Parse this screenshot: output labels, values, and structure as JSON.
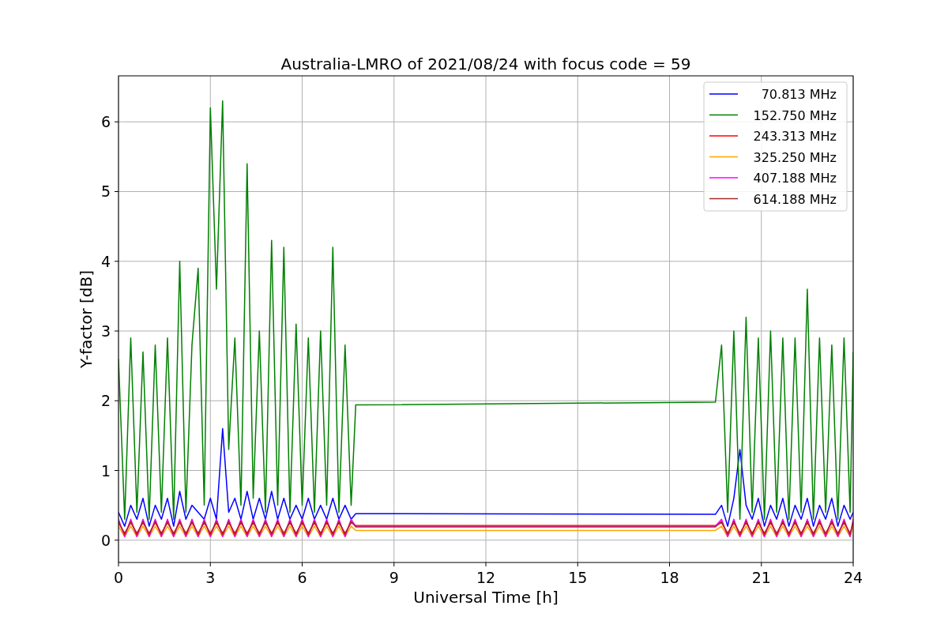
{
  "chart_data": {
    "type": "line",
    "title": "Australia-LMRO of 2021/08/24 with focus code = 59",
    "xlabel": "Universal Time [h]",
    "ylabel": "Y-factor [dB]",
    "x": [
      0,
      0.2,
      0.4,
      0.6,
      0.8,
      1.0,
      1.2,
      1.4,
      1.6,
      1.8,
      2.0,
      2.2,
      2.4,
      2.6,
      2.8,
      3.0,
      3.2,
      3.4,
      3.6,
      3.8,
      4.0,
      4.2,
      4.4,
      4.6,
      4.8,
      5.0,
      5.2,
      5.4,
      5.6,
      5.8,
      6.0,
      6.2,
      6.4,
      6.6,
      6.8,
      7.0,
      7.2,
      7.4,
      7.6,
      7.75,
      19.5,
      19.7,
      19.9,
      20.1,
      20.3,
      20.5,
      20.7,
      20.9,
      21.1,
      21.3,
      21.5,
      21.7,
      21.9,
      22.1,
      22.3,
      22.5,
      22.7,
      22.9,
      23.1,
      23.3,
      23.5,
      23.7,
      23.9,
      24
    ],
    "series": [
      {
        "name": "70.813 MHz",
        "color": "#0000ff",
        "values": [
          0.4,
          0.2,
          0.5,
          0.3,
          0.6,
          0.2,
          0.5,
          0.3,
          0.6,
          0.2,
          0.7,
          0.3,
          0.5,
          0.4,
          0.3,
          0.6,
          0.3,
          1.6,
          0.4,
          0.6,
          0.3,
          0.7,
          0.3,
          0.6,
          0.3,
          0.7,
          0.3,
          0.6,
          0.3,
          0.5,
          0.3,
          0.6,
          0.3,
          0.5,
          0.3,
          0.6,
          0.3,
          0.5,
          0.3,
          0.38,
          0.37,
          0.5,
          0.2,
          0.6,
          1.3,
          0.5,
          0.3,
          0.6,
          0.2,
          0.5,
          0.3,
          0.6,
          0.2,
          0.5,
          0.3,
          0.6,
          0.2,
          0.5,
          0.3,
          0.6,
          0.2,
          0.5,
          0.3,
          0.4
        ]
      },
      {
        "name": "152.750 MHz",
        "color": "#008000",
        "values": [
          2.6,
          0.3,
          2.9,
          0.4,
          2.7,
          0.3,
          2.8,
          0.4,
          2.9,
          0.3,
          4.0,
          0.4,
          2.8,
          3.9,
          0.5,
          6.2,
          3.6,
          6.3,
          1.3,
          2.9,
          0.5,
          5.4,
          0.6,
          3.0,
          0.4,
          4.3,
          0.5,
          4.2,
          0.4,
          3.1,
          0.5,
          2.9,
          0.4,
          3.0,
          0.5,
          4.2,
          0.4,
          2.8,
          0.5,
          1.94,
          1.98,
          2.8,
          0.4,
          3.0,
          0.3,
          3.2,
          0.4,
          2.9,
          0.3,
          3.0,
          0.4,
          2.9,
          0.3,
          2.9,
          0.4,
          3.6,
          0.3,
          2.9,
          0.4,
          2.8,
          0.3,
          2.9,
          0.4,
          2.7
        ]
      },
      {
        "name": "243.313 MHz",
        "color": "#ff0000",
        "values": [
          0.25,
          0.1,
          0.25,
          0.1,
          0.25,
          0.1,
          0.25,
          0.1,
          0.25,
          0.1,
          0.25,
          0.1,
          0.25,
          0.1,
          0.25,
          0.1,
          0.25,
          0.1,
          0.25,
          0.1,
          0.25,
          0.1,
          0.25,
          0.1,
          0.25,
          0.1,
          0.25,
          0.1,
          0.25,
          0.1,
          0.25,
          0.1,
          0.25,
          0.1,
          0.25,
          0.1,
          0.25,
          0.1,
          0.25,
          0.21,
          0.21,
          0.25,
          0.1,
          0.25,
          0.1,
          0.25,
          0.1,
          0.25,
          0.1,
          0.25,
          0.1,
          0.25,
          0.1,
          0.25,
          0.1,
          0.25,
          0.1,
          0.25,
          0.1,
          0.25,
          0.1,
          0.25,
          0.1,
          0.25
        ]
      },
      {
        "name": "325.250 MHz",
        "color": "#ffa500",
        "values": [
          0.2,
          0.05,
          0.2,
          0.05,
          0.2,
          0.05,
          0.2,
          0.05,
          0.2,
          0.05,
          0.2,
          0.05,
          0.2,
          0.05,
          0.2,
          0.05,
          0.2,
          0.05,
          0.2,
          0.05,
          0.2,
          0.05,
          0.2,
          0.05,
          0.2,
          0.05,
          0.2,
          0.05,
          0.2,
          0.05,
          0.2,
          0.05,
          0.2,
          0.05,
          0.2,
          0.05,
          0.2,
          0.05,
          0.2,
          0.14,
          0.14,
          0.2,
          0.05,
          0.2,
          0.05,
          0.2,
          0.05,
          0.2,
          0.05,
          0.2,
          0.05,
          0.2,
          0.05,
          0.2,
          0.05,
          0.2,
          0.05,
          0.2,
          0.05,
          0.2,
          0.05,
          0.2,
          0.05,
          0.2
        ]
      },
      {
        "name": "407.188 MHz",
        "color": "#ff00ff",
        "values": [
          0.3,
          0.05,
          0.3,
          0.05,
          0.3,
          0.05,
          0.3,
          0.05,
          0.3,
          0.05,
          0.3,
          0.05,
          0.3,
          0.05,
          0.3,
          0.05,
          0.3,
          0.05,
          0.3,
          0.05,
          0.3,
          0.05,
          0.3,
          0.05,
          0.3,
          0.05,
          0.3,
          0.05,
          0.3,
          0.05,
          0.3,
          0.05,
          0.3,
          0.05,
          0.3,
          0.05,
          0.3,
          0.05,
          0.3,
          0.2,
          0.2,
          0.3,
          0.05,
          0.3,
          0.05,
          0.3,
          0.05,
          0.3,
          0.05,
          0.3,
          0.05,
          0.3,
          0.05,
          0.3,
          0.05,
          0.3,
          0.05,
          0.3,
          0.05,
          0.3,
          0.05,
          0.3,
          0.05,
          0.3
        ]
      },
      {
        "name": "614.188 MHz",
        "color": "#a52a2a",
        "values": [
          0.27,
          0.08,
          0.27,
          0.08,
          0.27,
          0.08,
          0.27,
          0.08,
          0.27,
          0.08,
          0.27,
          0.08,
          0.27,
          0.08,
          0.27,
          0.08,
          0.27,
          0.08,
          0.27,
          0.08,
          0.27,
          0.08,
          0.27,
          0.08,
          0.27,
          0.08,
          0.27,
          0.08,
          0.27,
          0.08,
          0.27,
          0.08,
          0.27,
          0.08,
          0.27,
          0.08,
          0.27,
          0.08,
          0.27,
          0.19,
          0.19,
          0.27,
          0.08,
          0.27,
          0.08,
          0.27,
          0.08,
          0.27,
          0.08,
          0.27,
          0.08,
          0.27,
          0.08,
          0.27,
          0.08,
          0.27,
          0.08,
          0.27,
          0.08,
          0.27,
          0.08,
          0.27,
          0.08,
          0.27
        ]
      }
    ],
    "xlim": [
      0,
      24
    ],
    "ylim": [
      -0.32,
      6.66
    ],
    "xticks": [
      0,
      3,
      6,
      9,
      12,
      15,
      18,
      21,
      24
    ],
    "yticks": [
      0,
      1,
      2,
      3,
      4,
      5,
      6
    ],
    "grid": true,
    "legend": true
  }
}
